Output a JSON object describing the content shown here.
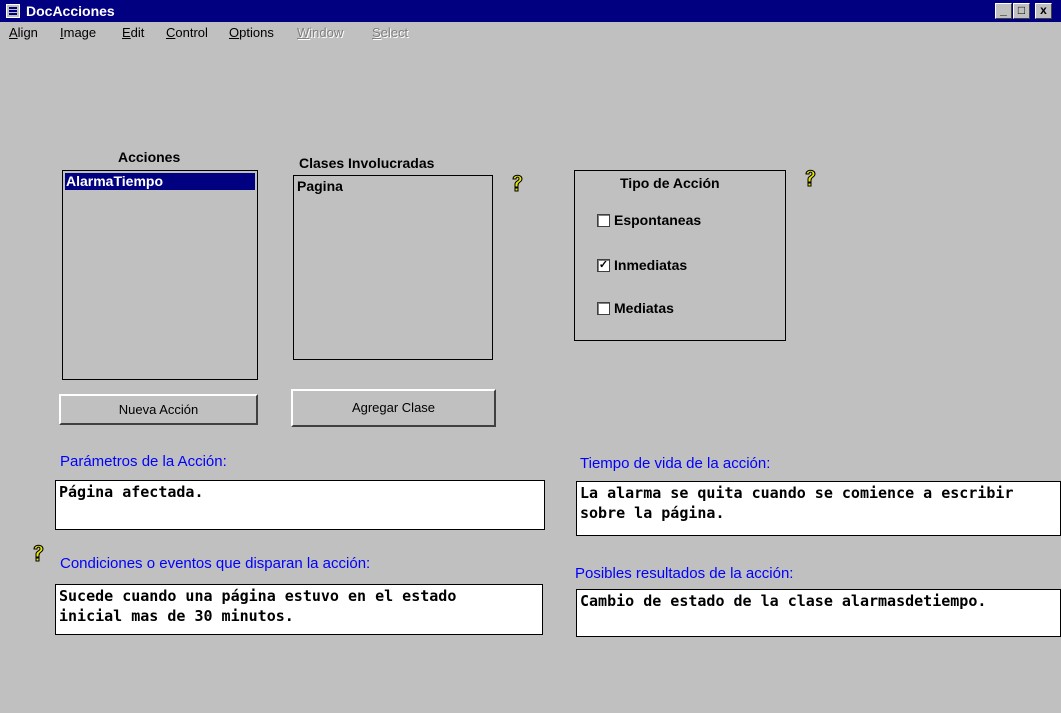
{
  "window": {
    "title": "DocAcciones",
    "controls": {
      "minimize": "_",
      "maximize": "□",
      "close": "x"
    }
  },
  "menu": [
    {
      "pre": "",
      "ul": "A",
      "post": "lign",
      "enabled": true
    },
    {
      "pre": "",
      "ul": "I",
      "post": "mage",
      "enabled": true
    },
    {
      "pre": "",
      "ul": "E",
      "post": "dit",
      "enabled": true
    },
    {
      "pre": "",
      "ul": "C",
      "post": "ontrol",
      "enabled": true
    },
    {
      "pre": "",
      "ul": "O",
      "post": "ptions",
      "enabled": true
    },
    {
      "pre": "",
      "ul": "W",
      "post": "indow",
      "enabled": false
    },
    {
      "pre": "",
      "ul": "S",
      "post": "elect",
      "enabled": false
    }
  ],
  "acciones": {
    "label": "Acciones",
    "items": [
      {
        "text": "AlarmaTiempo",
        "selected": true
      }
    ],
    "button": "Nueva Acción"
  },
  "clases": {
    "label": "Clases Involucradas",
    "items": [
      {
        "text": "Pagina",
        "selected": false
      }
    ],
    "button": "Agregar Clase"
  },
  "tipo": {
    "label": "Tipo de Acción",
    "options": [
      {
        "label": "Espontaneas",
        "checked": false
      },
      {
        "label": "Inmediatas",
        "checked": true
      },
      {
        "label": "Mediatas",
        "checked": false
      }
    ]
  },
  "fields": {
    "parametros": {
      "label": "Parámetros de la Acción:",
      "value": "Página afectada."
    },
    "tiempo": {
      "label": "Tiempo de vida de la acción:",
      "value": "La alarma se quita cuando se comience a escribir\nsobre la página."
    },
    "condiciones": {
      "label": "Condiciones o eventos que disparan la acción:",
      "value": "Sucede cuando una página estuvo en el estado\ninicial mas de 30 minutos."
    },
    "resultados": {
      "label": "Posibles resultados de la acción:",
      "value": "Cambio de estado de la clase alarmasdetiempo."
    }
  },
  "help_icon_glyph": "?",
  "check_glyph": "✓",
  "colors": {
    "titlebar": "#000080",
    "face": "#c0c0c0",
    "label_blue": "#0000ff",
    "help": "#e6e600"
  }
}
